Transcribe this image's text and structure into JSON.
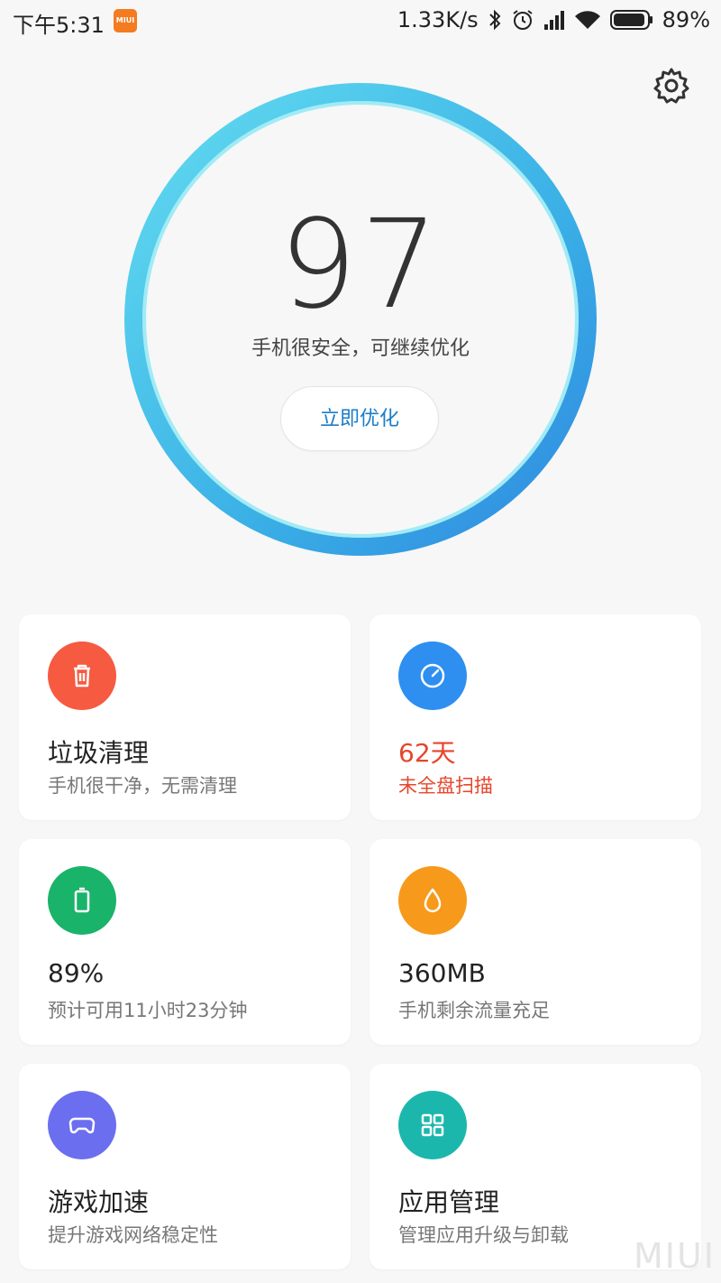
{
  "status_bar": {
    "time": "下午5:31",
    "miui_badge": "MIUI",
    "net_speed": "1.33K/s",
    "battery": "89%",
    "icons": [
      "bluetooth-icon",
      "alarm-icon",
      "signal-icon",
      "wifi-icon",
      "battery-icon"
    ]
  },
  "score": {
    "value": "97",
    "status": "手机很安全，可继续优化",
    "button": "立即优化"
  },
  "cards": [
    {
      "title": "垃圾清理",
      "sub": "手机很干净，无需清理",
      "icon": "trash-icon",
      "color": "#f65a40"
    },
    {
      "title": "62天",
      "sub": "未全盘扫描",
      "icon": "gauge-icon",
      "color": "#2e8ff0"
    },
    {
      "title": "89%",
      "sub": "预计可用11小时23分钟",
      "icon": "battery-icon",
      "color": "#1ab36a"
    },
    {
      "title": "360MB",
      "sub": "手机剩余流量充足",
      "icon": "drop-icon",
      "color": "#f79a1b"
    },
    {
      "title": "游戏加速",
      "sub": "提升游戏网络稳定性",
      "icon": "gamepad-icon",
      "color": "#6c6ef0"
    },
    {
      "title": "应用管理",
      "sub": "管理应用升级与卸载",
      "icon": "apps-grid-icon",
      "color": "#1cb7ac"
    }
  ],
  "watermark": "MIUI",
  "colors": {
    "accent": "#1b7cc8",
    "warning": "#e5462b",
    "background": "#f7f7f7"
  }
}
